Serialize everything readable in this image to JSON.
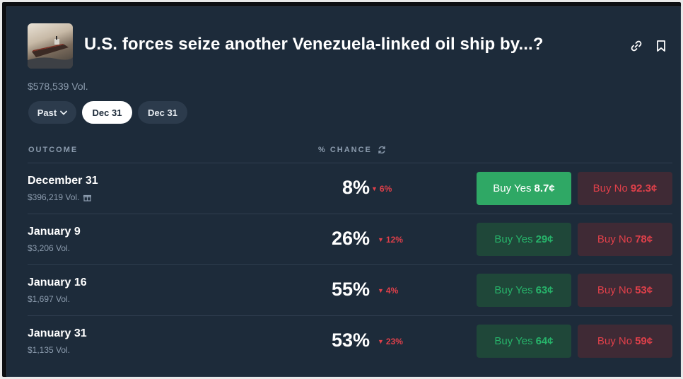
{
  "market": {
    "title": "U.S. forces seize another Venezuela-linked oil ship by...?",
    "volume": "$578,539 Vol.",
    "image_alt": "oil tanker ship"
  },
  "filters": {
    "past_label": "Past",
    "pills": [
      "Dec 31",
      "Dec 31"
    ]
  },
  "table": {
    "outcome_header": "OUTCOME",
    "chance_header": "% CHANCE",
    "buy_yes_label": "Buy Yes",
    "buy_no_label": "Buy No",
    "rows": [
      {
        "date": "December 31",
        "volume": "$396,219 Vol.",
        "chance": "8%",
        "delta": "6%",
        "yes_price": "8.7¢",
        "no_price": "92.3¢"
      },
      {
        "date": "January 9",
        "volume": "$3,206 Vol.",
        "chance": "26%",
        "delta": "12%",
        "yes_price": "29¢",
        "no_price": "78¢"
      },
      {
        "date": "January 16",
        "volume": "$1,697 Vol.",
        "chance": "55%",
        "delta": "4%",
        "yes_price": "63¢",
        "no_price": "53¢"
      },
      {
        "date": "January 31",
        "volume": "$1,135 Vol.",
        "chance": "53%",
        "delta": "23%",
        "yes_price": "64¢",
        "no_price": "59¢"
      }
    ]
  },
  "colors": {
    "card_bg": "#1d2b3a",
    "yes_green": "#27b36a",
    "no_red": "#e0404a",
    "muted_text": "#8b9bad"
  }
}
